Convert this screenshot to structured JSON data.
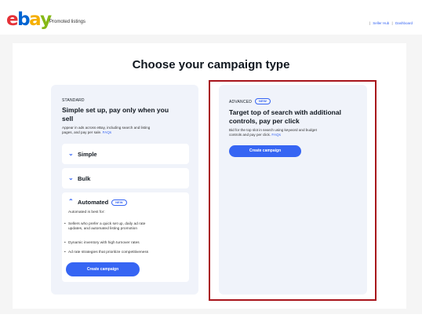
{
  "header": {
    "logo_letters": [
      {
        "char": "e",
        "color": "#e53238"
      },
      {
        "char": "b",
        "color": "#0064d2"
      },
      {
        "char": "a",
        "color": "#f5af02"
      },
      {
        "char": "y",
        "color": "#86b817"
      }
    ],
    "title": "Promoted listings",
    "links": [
      "Seller Hub",
      "Dashboard"
    ]
  },
  "page": {
    "title": "Choose your campaign type"
  },
  "standard": {
    "overline": "STANDARD",
    "heading_line1": "Simple set up, pay only when you",
    "heading_line2": "sell",
    "desc_line1": "Appear in ads across eBay, including search and listing",
    "desc_line2": "pages, and pay per sale.",
    "faq": "FAQs",
    "sections": {
      "simple": "Simple",
      "bulk": "Bulk",
      "automated": "Automated",
      "automated_badge": "NEW"
    },
    "automated_intro": "Automated is best for:",
    "bullets": [
      [
        "Sellers who prefer a quick set up, daily ad rate",
        "updates, and automated listing promotion"
      ],
      [
        "Dynamic inventory with high turnover rates"
      ],
      [
        "Ad rate strategies that prioritize competitiveness"
      ]
    ],
    "button": "Create campaign"
  },
  "advanced": {
    "overline": "ADVANCED",
    "badge": "NEW",
    "heading_line1": "Target top of search with additional",
    "heading_line2": "controls, pay per click",
    "desc_line1": "Bid for the top slot in search using keyword and budget",
    "desc_line2": "controls and pay per click.",
    "faq": "FAQs",
    "button": "Create campaign"
  },
  "colors": {
    "accent": "#3665f3",
    "highlight": "#a8141b",
    "card_bg": "#f0f3fa"
  }
}
